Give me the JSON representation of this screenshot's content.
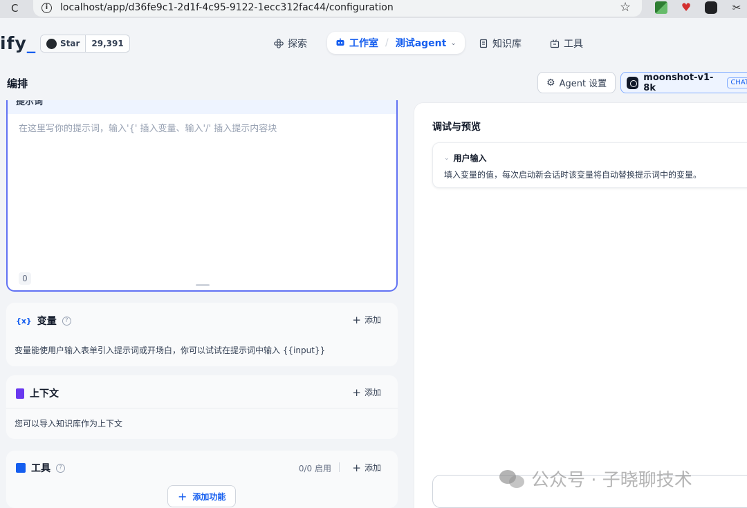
{
  "browser": {
    "url": "localhost/app/d36fe9c1-2d1f-4c95-9122-1ecc312fac44/configuration"
  },
  "header": {
    "logo_text": "ify",
    "github": {
      "star_label": "Star",
      "star_count": "29,391"
    },
    "nav": {
      "explore": "探索",
      "studio": "工作室",
      "app_name": "测试agent",
      "knowledge": "知识库",
      "tools": "工具"
    }
  },
  "page": {
    "title": "编排",
    "agent_settings": "Agent 设置",
    "model_name": "moonshot-v1-8k",
    "model_badge": "CHAT"
  },
  "prompt": {
    "label": "提示词",
    "placeholder": "在这里写你的提示词，输入'{' 插入变量、输入'/' 插入提示内容块",
    "char_count": "0"
  },
  "variables": {
    "title": "变量",
    "icon": "{x}",
    "add": "添加",
    "description": "变量能使用户输入表单引入提示词或开场白，你可以试试在提示词中输入 {{input}}"
  },
  "context": {
    "title": "上下文",
    "add": "添加",
    "description": "您可以导入知识库作为上下文"
  },
  "tools_section": {
    "title": "工具",
    "enabled": "0/0 启用",
    "add": "添加"
  },
  "add_feature": "添加功能",
  "preview": {
    "title": "调试与预览",
    "user_input_title": "用户输入",
    "user_input_desc": "填入变量的值，每次启动新会话时该变量将自动替换提示词中的变量。"
  },
  "watermark": "公众号 · 子晓聊技术"
}
